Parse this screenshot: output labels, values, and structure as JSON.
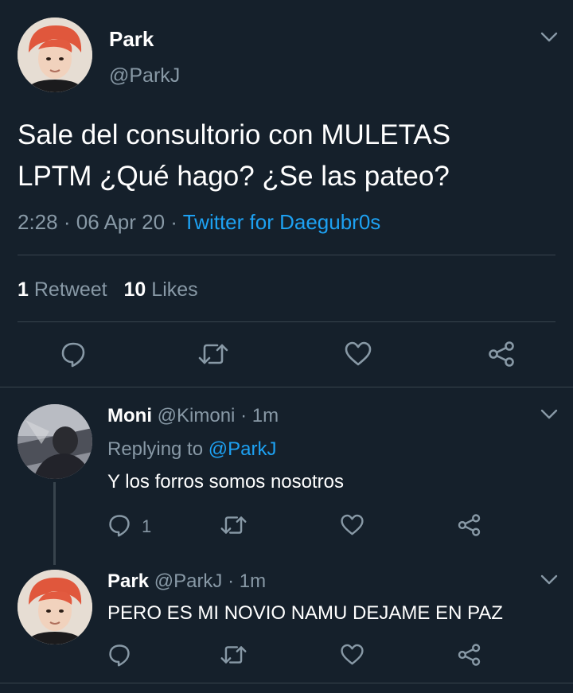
{
  "main_tweet": {
    "author_name": "Park",
    "author_handle": "@ParkJ",
    "text_line1": "Sale del consultorio con MULETAS",
    "text_line2": "LPTM ¿Qué hago? ¿Se las pateo?",
    "time": "2:28",
    "date": "06 Apr 20",
    "source": "Twitter for Daegubr0s",
    "retweet_count": "1",
    "retweet_label": "Retweet",
    "like_count": "10",
    "like_label": "Likes"
  },
  "reply1": {
    "author_name": "Moni",
    "author_handle": "@Kimoni",
    "age": "1m",
    "replying_prefix": "Replying to",
    "replying_handle": "@ParkJ",
    "text": "Y los forros somos nosotros",
    "reply_count": "1"
  },
  "reply2": {
    "author_name": "Park",
    "author_handle": "@ParkJ",
    "age": "1m",
    "text": "PERO ES MI NOVIO NAMU DEJAME EN PAZ"
  },
  "separator": "·",
  "colors": {
    "background": "#15202b",
    "text": "#ffffff",
    "muted": "#8899a6",
    "accent": "#1da1f2",
    "divider": "#38444d"
  }
}
